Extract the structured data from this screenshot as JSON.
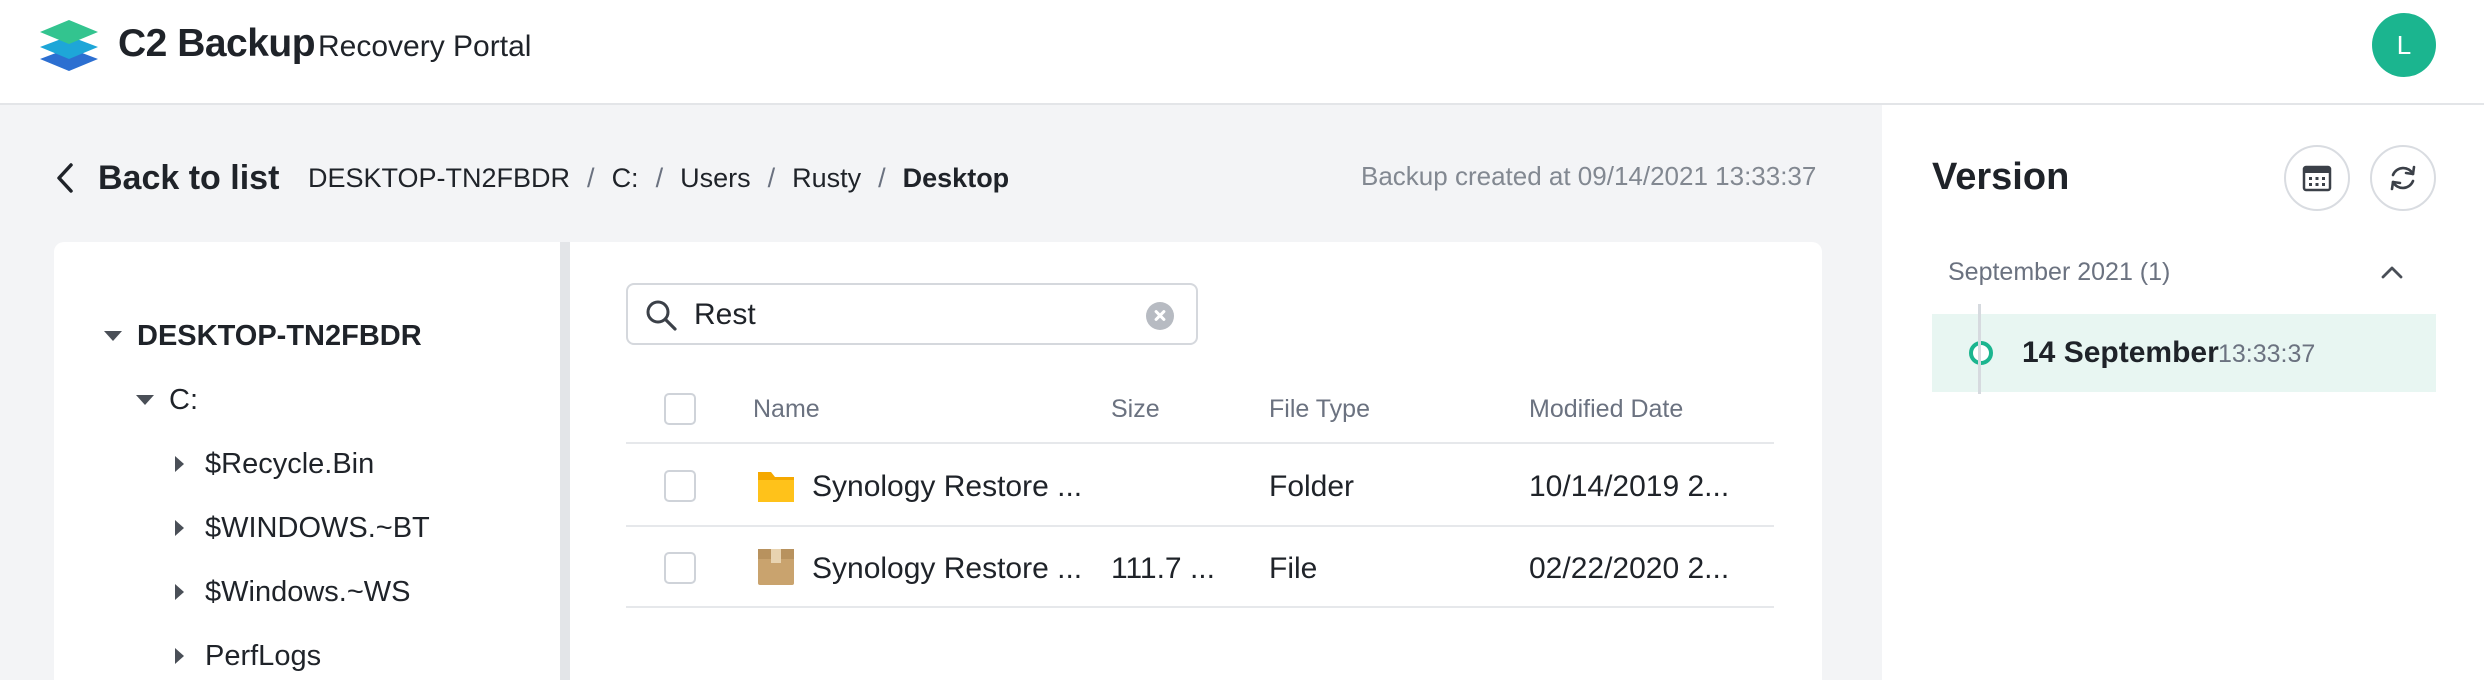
{
  "header": {
    "brand": "C2 Backup",
    "subtitle": "Recovery Portal",
    "avatar_initial": "L",
    "avatar_color": "#1bb58f"
  },
  "toolbar": {
    "back_label": "Back to list",
    "breadcrumbs": [
      "DESKTOP-TN2FBDR",
      "C:",
      "Users",
      "Rusty",
      "Desktop"
    ],
    "backup_info": "Backup created at 09/14/2021 13:33:37"
  },
  "tree": {
    "root": {
      "label": "DESKTOP-TN2FBDR",
      "icon": "caret-down-icon",
      "expanded": true
    },
    "drive": {
      "label": "C:",
      "icon": "caret-down-icon",
      "expanded": true
    },
    "items": [
      {
        "label": "$Recycle.Bin",
        "icon": "caret-right-icon"
      },
      {
        "label": "$WINDOWS.~BT",
        "icon": "caret-right-icon"
      },
      {
        "label": "$Windows.~WS",
        "icon": "caret-right-icon"
      },
      {
        "label": "PerfLogs",
        "icon": "caret-right-icon"
      }
    ]
  },
  "search": {
    "value": "Rest",
    "icon": "search-icon",
    "clear_icon": "clear-icon"
  },
  "table": {
    "columns": [
      "Name",
      "Size",
      "File Type",
      "Modified Date"
    ],
    "rows": [
      {
        "icon": "folder-icon",
        "name": "Synology Restore ...",
        "size": "",
        "type": "Folder",
        "modified": "10/14/2019 2..."
      },
      {
        "icon": "package-icon",
        "name": "Synology Restore ...",
        "size": "111.7 ...",
        "type": "File",
        "modified": "02/22/2020 2..."
      }
    ]
  },
  "version": {
    "title": "Version",
    "calendar_icon": "calendar-icon",
    "refresh_icon": "refresh-icon",
    "groups": [
      {
        "label": "September 2021 (1)",
        "expanded": true,
        "items": [
          {
            "date": "14 September",
            "time": "13:33:37",
            "selected": true
          }
        ]
      }
    ]
  },
  "colors": {
    "accent": "#1bb58f",
    "selected_bg": "#e8f6f2",
    "folder": "#f5b400",
    "package": "#c9a36e"
  }
}
